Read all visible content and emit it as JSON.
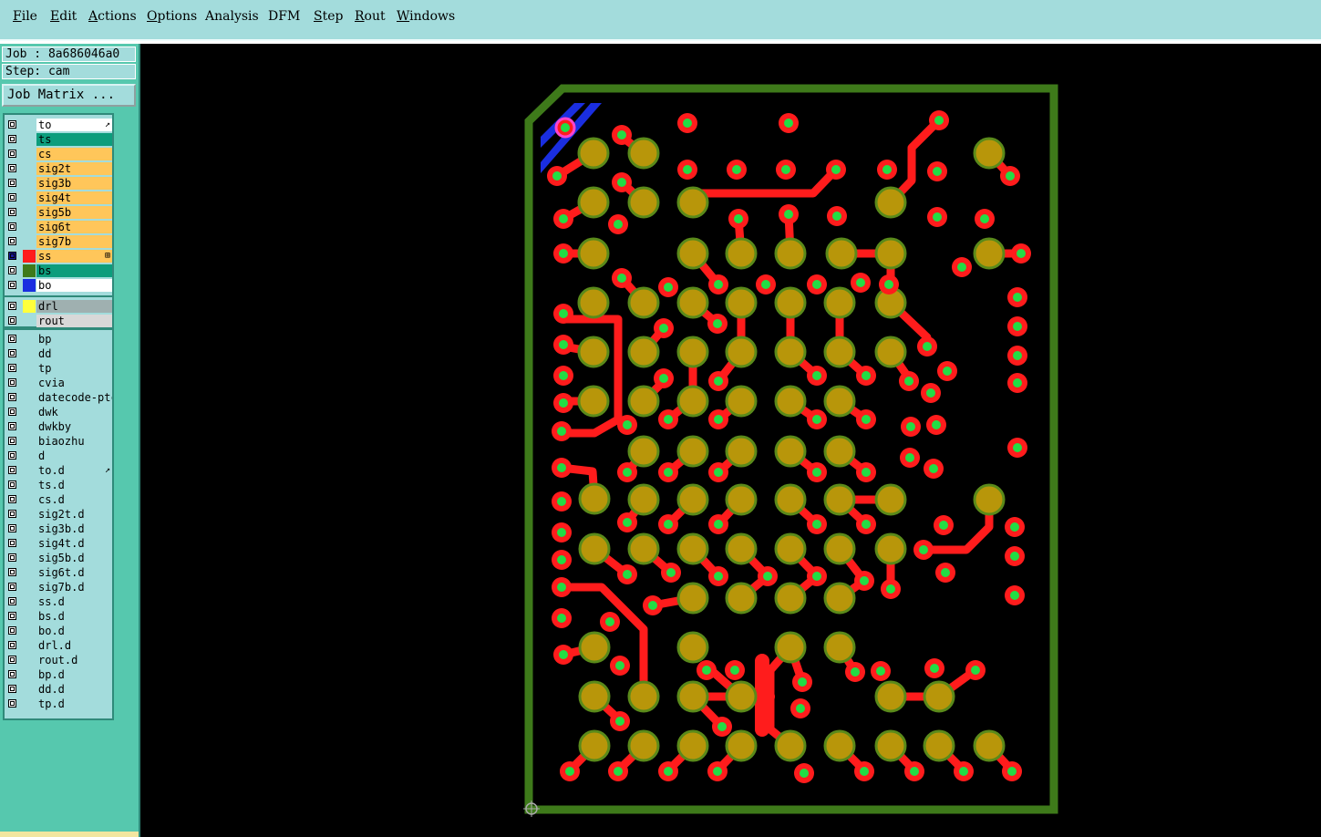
{
  "menu": [
    {
      "pre": "",
      "u": "F",
      "post": "ile"
    },
    {
      "pre": "",
      "u": "E",
      "post": "dit"
    },
    {
      "pre": "",
      "u": "A",
      "post": "ctions"
    },
    {
      "pre": "",
      "u": "O",
      "post": "ptions"
    },
    {
      "pre": "",
      "u": "",
      "post": "Analysis"
    },
    {
      "pre": "",
      "u": "",
      "post": "DFM"
    },
    {
      "pre": "",
      "u": "S",
      "post": "tep"
    },
    {
      "pre": "",
      "u": "R",
      "post": "out"
    },
    {
      "pre": "",
      "u": "W",
      "post": "indows"
    }
  ],
  "job_line": "Job : 8a686046a0",
  "step_line": "Step: cam",
  "job_matrix_label": "Job Matrix ...",
  "board_layers": [
    {
      "name": "to",
      "bg": "#ffffff",
      "swatch": "",
      "marker": "↗",
      "checked": false
    },
    {
      "name": "ts",
      "bg": "#0c9d7c",
      "swatch": "",
      "marker": "",
      "checked": false
    },
    {
      "name": "cs",
      "bg": "#ffc65a",
      "swatch": "",
      "marker": "",
      "checked": false
    },
    {
      "name": "sig2t",
      "bg": "#ffc65a",
      "swatch": "",
      "marker": "",
      "checked": false
    },
    {
      "name": "sig3b",
      "bg": "#ffc65a",
      "swatch": "",
      "marker": "",
      "checked": false
    },
    {
      "name": "sig4t",
      "bg": "#ffc65a",
      "swatch": "",
      "marker": "",
      "checked": false
    },
    {
      "name": "sig5b",
      "bg": "#ffc65a",
      "swatch": "",
      "marker": "",
      "checked": false
    },
    {
      "name": "sig6t",
      "bg": "#ffc65a",
      "swatch": "",
      "marker": "",
      "checked": false
    },
    {
      "name": "sig7b",
      "bg": "#ffc65a",
      "swatch": "",
      "marker": "",
      "checked": false
    },
    {
      "name": "ss",
      "bg": "#ffc65a",
      "swatch": "#ff1c1c",
      "marker": "⊞",
      "checked": true
    },
    {
      "name": "bs",
      "bg": "#0c9d7c",
      "swatch": "#3e7a1a",
      "marker": "",
      "checked": false
    },
    {
      "name": "bo",
      "bg": "#ffffff",
      "swatch": "#1a2ee0",
      "marker": "",
      "checked": false
    }
  ],
  "drill_layers": [
    {
      "name": "drl",
      "bg": "#9fb0b0",
      "swatch": "#ffff3c",
      "marker": "",
      "checked": false
    },
    {
      "name": "rout",
      "bg": "#d8d8d8",
      "swatch": "",
      "marker": "",
      "checked": false
    }
  ],
  "misc_layers": [
    {
      "name": "bp",
      "marker": ""
    },
    {
      "name": "dd",
      "marker": ""
    },
    {
      "name": "tp",
      "marker": ""
    },
    {
      "name": "cvia",
      "marker": ""
    },
    {
      "name": "datecode-ptc",
      "marker": ""
    },
    {
      "name": "dwk",
      "marker": ""
    },
    {
      "name": "dwkby",
      "marker": ""
    },
    {
      "name": "biaozhu",
      "marker": ""
    },
    {
      "name": "d",
      "marker": ""
    },
    {
      "name": "to.d",
      "marker": "↗"
    },
    {
      "name": "ts.d",
      "marker": ""
    },
    {
      "name": "cs.d",
      "marker": ""
    },
    {
      "name": "sig2t.d",
      "marker": ""
    },
    {
      "name": "sig3b.d",
      "marker": ""
    },
    {
      "name": "sig4t.d",
      "marker": ""
    },
    {
      "name": "sig5b.d",
      "marker": ""
    },
    {
      "name": "sig6t.d",
      "marker": ""
    },
    {
      "name": "sig7b.d",
      "marker": ""
    },
    {
      "name": "ss.d",
      "marker": ""
    },
    {
      "name": "bs.d",
      "marker": ""
    },
    {
      "name": "bo.d",
      "marker": ""
    },
    {
      "name": "drl.d",
      "marker": ""
    },
    {
      "name": "rout.d",
      "marker": ""
    },
    {
      "name": "bp.d",
      "marker": ""
    },
    {
      "name": "dd.d",
      "marker": ""
    },
    {
      "name": "tp.d",
      "marker": ""
    }
  ],
  "colors": {
    "menubar": "#a3dcdc",
    "panel": "#56c8ae",
    "canvas": "#000000",
    "outline": "#3e7a1a",
    "pad": "#b8960a",
    "pad_ring": "#5a8a1a",
    "trace": "#ff1c1c",
    "via_hole": "#22dd44",
    "silk_blue": "#1a2ee0",
    "marker": "#ff44cc"
  }
}
